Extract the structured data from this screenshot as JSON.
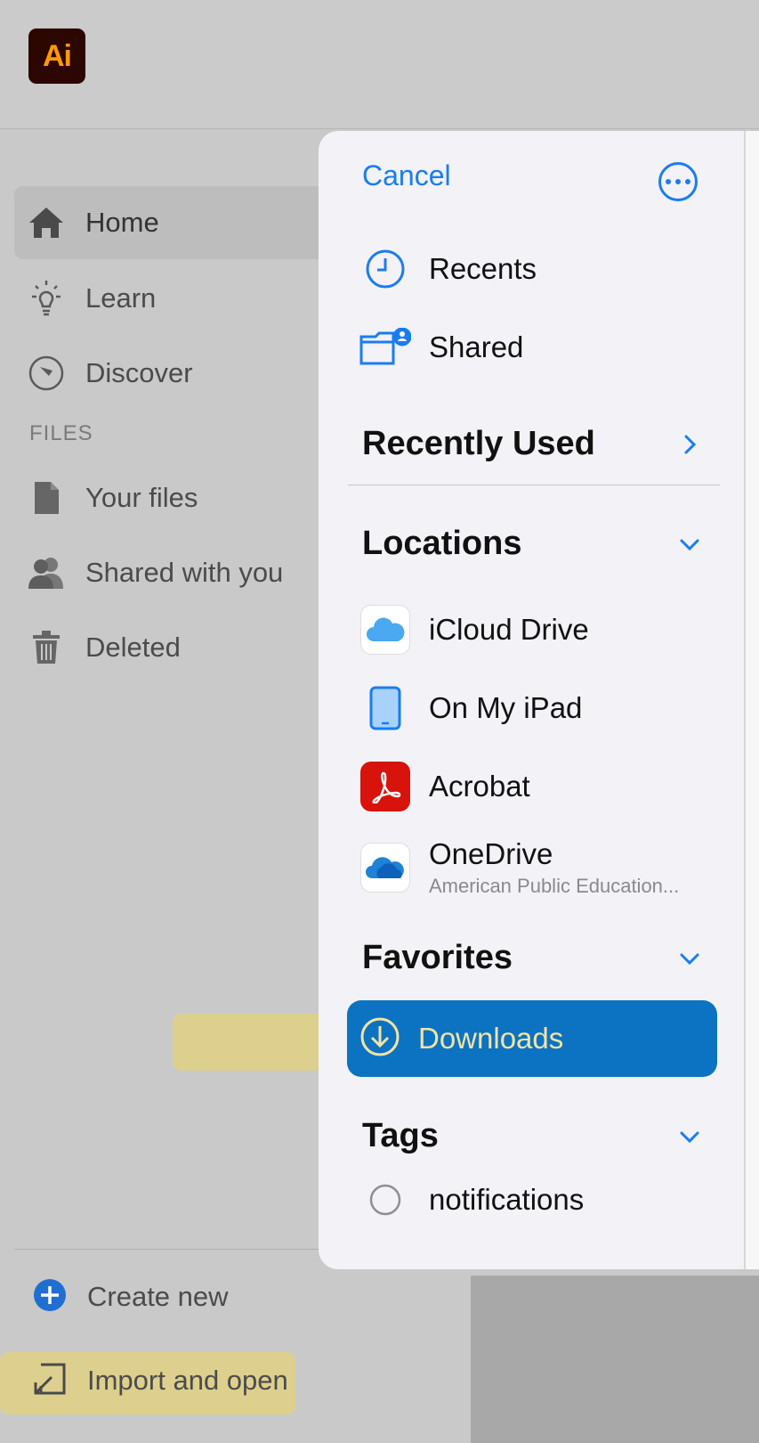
{
  "app": {
    "logo_text": "Ai",
    "brand_color": "#ff9a00"
  },
  "sidebar": {
    "items": [
      {
        "label": "Home",
        "icon": "home-icon",
        "active": true
      },
      {
        "label": "Learn",
        "icon": "lightbulb-icon"
      },
      {
        "label": "Discover",
        "icon": "compass-icon"
      }
    ],
    "files_heading": "FILES",
    "file_items": [
      {
        "label": "Your files",
        "icon": "file-icon"
      },
      {
        "label": "Shared with you",
        "icon": "people-icon"
      },
      {
        "label": "Deleted",
        "icon": "trash-icon"
      }
    ],
    "create_new": "Create new",
    "import_open": "Import and open"
  },
  "picker": {
    "cancel": "Cancel",
    "more_icon": "ellipsis-circle-icon",
    "recents": "Recents",
    "shared": "Shared",
    "recently_used": "Recently Used",
    "locations_title": "Locations",
    "locations": [
      {
        "label": "iCloud Drive",
        "icon": "icloud-icon"
      },
      {
        "label": "On My iPad",
        "icon": "ipad-icon"
      },
      {
        "label": "Acrobat",
        "icon": "acrobat-icon"
      },
      {
        "label": "OneDrive",
        "sublabel": "American Public Education...",
        "icon": "onedrive-icon"
      }
    ],
    "favorites_title": "Favorites",
    "favorites": [
      {
        "label": "Downloads",
        "icon": "download-circle-icon",
        "selected": true
      }
    ],
    "tags_title": "Tags",
    "tags": [
      {
        "label": "notifications",
        "icon": "tag-circle-icon"
      }
    ],
    "accent_color": "#1a7cf2",
    "selection_color": "#0b73c2"
  }
}
